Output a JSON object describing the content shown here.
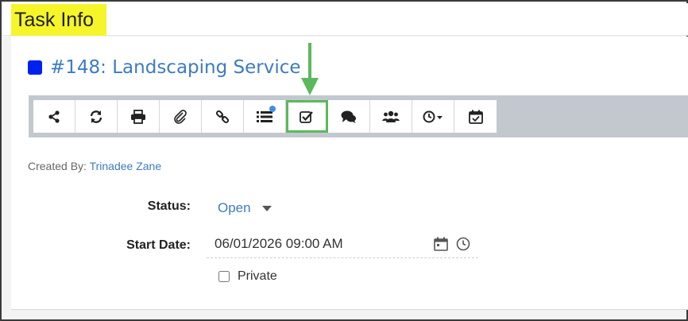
{
  "panel": {
    "title": "Task Info"
  },
  "task": {
    "title": "#148: Landscaping Service",
    "color": "#0020f0"
  },
  "toolbar": {
    "buttons": [
      {
        "icon": "share-icon"
      },
      {
        "icon": "refresh-icon"
      },
      {
        "icon": "print-icon"
      },
      {
        "icon": "paperclip-icon"
      },
      {
        "icon": "link-icon"
      },
      {
        "icon": "list-icon",
        "notification": true
      },
      {
        "icon": "checkbox-check-icon",
        "highlighted": true
      },
      {
        "icon": "comments-icon"
      },
      {
        "icon": "users-icon"
      },
      {
        "icon": "clock-dropdown-icon"
      },
      {
        "icon": "calendar-check-icon"
      }
    ]
  },
  "meta": {
    "created_by_label": "Created By:",
    "created_by": "Trinadee Zane"
  },
  "fields": {
    "status_label": "Status:",
    "status_value": "Open",
    "start_date_label": "Start Date:",
    "start_date_value": "06/01/2026 09:00 AM",
    "private_label": "Private"
  },
  "colors": {
    "link": "#3d7bc3",
    "highlight": "#f5f52a",
    "arrow": "#5cb85c"
  }
}
